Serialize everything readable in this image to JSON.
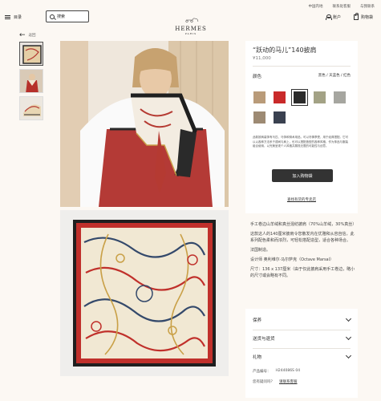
{
  "top_links": [
    "中国内地",
    "联系处客服",
    "与我联系"
  ],
  "header": {
    "menu_label": "目录",
    "search_placeholder": "搜索",
    "logo_name": "HERMES",
    "logo_city": "PARIS",
    "account_label": "账户",
    "bag_label": "购物袋"
  },
  "back_label": "返回",
  "product": {
    "title": "“跃动的马儿”140披肩",
    "price": "¥11,000",
    "color_label": "颜色",
    "color_name": "黑色 / 天蓝色 / 红色",
    "swatches": [
      {
        "name": "swatch-beige",
        "color": "#b99b79"
      },
      {
        "name": "swatch-red",
        "color": "#c92a2a"
      },
      {
        "name": "swatch-black",
        "color": "#2b2b2b"
      },
      {
        "name": "swatch-green",
        "color": "#a3a285"
      },
      {
        "name": "swatch-grey",
        "color": "#a6a6a0"
      },
      {
        "name": "swatch-taupe",
        "color": "#9d8a73"
      },
      {
        "name": "swatch-navy",
        "color": "#3a4150"
      }
    ],
    "description": "此款披肩装饰有马匹、马饰和骑术用品，可以尽情享受，用于经典搭配。它可以以各种方法系于颈间与肩上，也可以搭配造型的各种风格，作为饰品与服装组合使用，以完美呈现个人风格并展现无限的可能性与创意。",
    "add_to_cart": "加入购物袋",
    "store_link": "查找有货的专卖店",
    "details": [
      "手工卷边山羊绒和真丝混纺披肩（70%山羊绒，30%真丝）",
      "这款这人的140厘米披肩令您散发内在优雅和从容自信，此系列配色柔和而浓烈，可轻松搭配造型，适合各种场合。",
      "法国制造。",
      "设计师 奥利维尔·马尔萨克（Octave Marsal）",
      "尺寸：136 x 137厘米（由于仅此披肩采用手工卷边，略小的尺寸或会略有不同。"
    ]
  },
  "accordion": {
    "items": [
      "保养",
      "送货与退货",
      "礼物"
    ],
    "product_code_label": "产品编号：",
    "product_code": "H244086S 04",
    "question": "您有疑问吗？",
    "contact_link": "请联系客服"
  }
}
